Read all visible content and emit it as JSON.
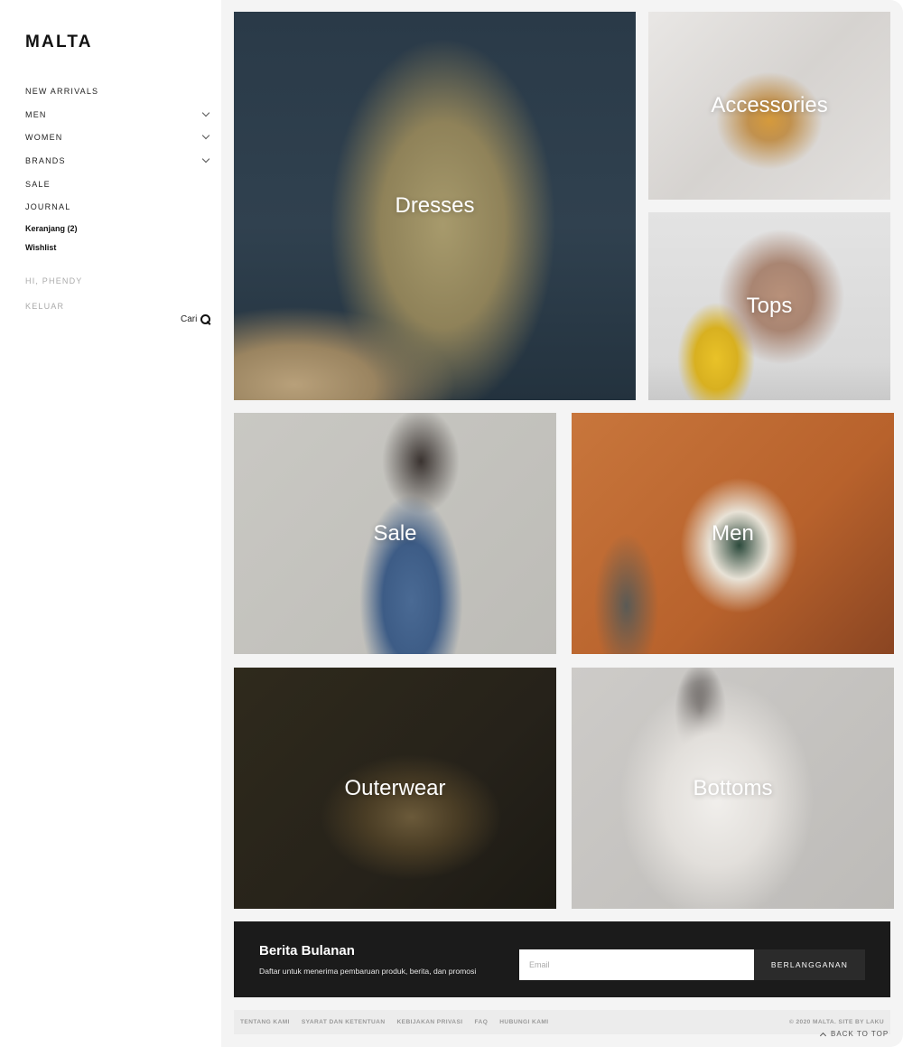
{
  "brand": {
    "logo": "MALTA"
  },
  "nav": {
    "items": [
      {
        "label": "NEW ARRIVALS",
        "has_submenu": false
      },
      {
        "label": "MEN",
        "has_submenu": true
      },
      {
        "label": "WOMEN",
        "has_submenu": true
      },
      {
        "label": "BRANDS",
        "has_submenu": true
      },
      {
        "label": "SALE",
        "has_submenu": false
      },
      {
        "label": "JOURNAL",
        "has_submenu": false
      }
    ]
  },
  "account": {
    "cart_label": "Keranjang (2)",
    "wishlist_label": "Wishlist",
    "greeting": "HI, PHENDY",
    "logout_label": "KELUAR"
  },
  "search": {
    "label": "Cari"
  },
  "categories": [
    {
      "label": "Dresses"
    },
    {
      "label": "Accessories"
    },
    {
      "label": "Tops"
    },
    {
      "label": "Sale"
    },
    {
      "label": "Men"
    },
    {
      "label": "Outerwear"
    },
    {
      "label": "Bottoms"
    }
  ],
  "newsletter": {
    "title": "Berita Bulanan",
    "subtitle": "Daftar untuk menerima pembaruan produk, berita, dan promosi",
    "email_placeholder": "Email",
    "button_label": "BERLANGGANAN"
  },
  "footer": {
    "links": [
      "TENTANG KAMI",
      "SYARAT DAN KETENTUAN",
      "KEBIJAKAN PRIVASI",
      "FAQ",
      "HUBUNGI KAMI"
    ],
    "copyright": "© 2020 MALTA. SITE BY LAKU",
    "back_to_top": "BACK TO TOP"
  }
}
